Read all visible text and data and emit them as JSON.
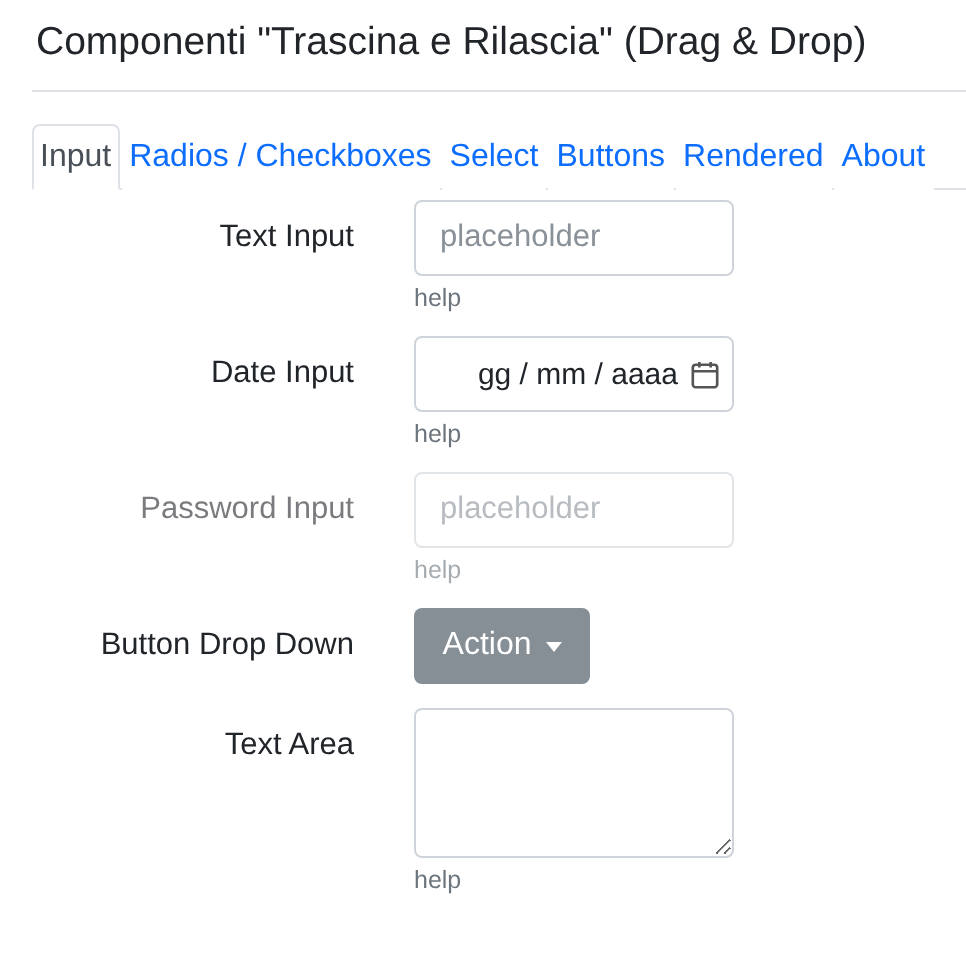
{
  "title": "Componenti \"Trascina e Rilascia\" (Drag & Drop)",
  "tabs": [
    {
      "label": "Input",
      "selected": true
    },
    {
      "label": "Radios / Checkboxes",
      "selected": false
    },
    {
      "label": "Select",
      "selected": false
    },
    {
      "label": "Buttons",
      "selected": false
    },
    {
      "label": "Rendered",
      "selected": false
    },
    {
      "label": "About",
      "selected": false
    }
  ],
  "fields": [
    {
      "kind": "text",
      "label": "Text Input",
      "placeholder": "placeholder",
      "help": "help",
      "blurred": false
    },
    {
      "kind": "date",
      "label": "Date Input",
      "value": "gg / mm / aaaa",
      "help": "help",
      "blurred": false
    },
    {
      "kind": "password",
      "label": "Password Input",
      "placeholder": "placeholder",
      "help": "help",
      "blurred": true
    },
    {
      "kind": "dropdown",
      "label": "Button Drop Down",
      "button": "Action",
      "blurred": false
    },
    {
      "kind": "textarea",
      "label": "Text Area",
      "help": "help",
      "blurred": false
    }
  ]
}
